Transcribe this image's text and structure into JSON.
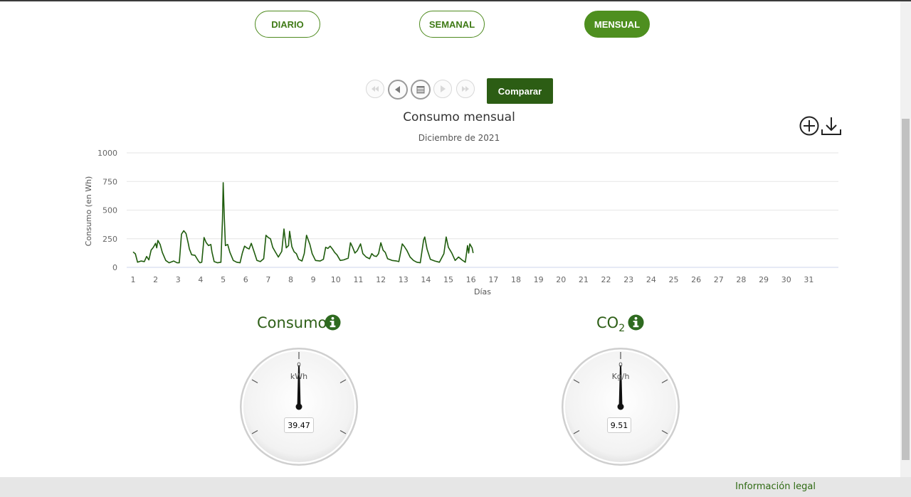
{
  "tabs": [
    {
      "label": "DIARIO",
      "active": false
    },
    {
      "label": "SEMANAL",
      "active": false
    },
    {
      "label": "MENSUAL",
      "active": true
    }
  ],
  "nav": {
    "compare_label": "Comparar",
    "buttons": [
      "first-icon",
      "prev-icon",
      "calendar-icon",
      "next-icon",
      "last-icon"
    ]
  },
  "tools": [
    "zoom-in-icon",
    "download-icon"
  ],
  "chart_data": {
    "type": "line",
    "title": "Consumo mensual",
    "subtitle": "Diciembre de 2021",
    "xlabel": "Días",
    "ylabel": "Consumo (en Wh)",
    "ylim": [
      0,
      1000
    ],
    "yticks": [
      "0",
      "250",
      "500",
      "750",
      "1000"
    ],
    "xlim": [
      1,
      32
    ],
    "xticks": [
      "1",
      "2",
      "3",
      "4",
      "5",
      "6",
      "7",
      "8",
      "9",
      "10",
      "11",
      "12",
      "13",
      "14",
      "15",
      "16",
      "17",
      "18",
      "19",
      "20",
      "21",
      "22",
      "23",
      "24",
      "25",
      "26",
      "27",
      "28",
      "29",
      "30",
      "31"
    ],
    "color": "#1f5c0d",
    "grid": true,
    "points": [
      [
        1.0,
        135
      ],
      [
        1.1,
        118
      ],
      [
        1.2,
        45
      ],
      [
        1.35,
        55
      ],
      [
        1.5,
        50
      ],
      [
        1.6,
        95
      ],
      [
        1.7,
        65
      ],
      [
        1.8,
        150
      ],
      [
        1.9,
        175
      ],
      [
        2.0,
        210
      ],
      [
        2.05,
        170
      ],
      [
        2.1,
        235
      ],
      [
        2.2,
        200
      ],
      [
        2.3,
        130
      ],
      [
        2.45,
        60
      ],
      [
        2.6,
        40
      ],
      [
        2.8,
        55
      ],
      [
        2.95,
        40
      ],
      [
        3.05,
        40
      ],
      [
        3.15,
        290
      ],
      [
        3.25,
        320
      ],
      [
        3.35,
        295
      ],
      [
        3.45,
        210
      ],
      [
        3.5,
        160
      ],
      [
        3.6,
        110
      ],
      [
        3.75,
        105
      ],
      [
        3.9,
        55
      ],
      [
        3.97,
        40
      ],
      [
        4.05,
        45
      ],
      [
        4.15,
        260
      ],
      [
        4.25,
        215
      ],
      [
        4.35,
        190
      ],
      [
        4.45,
        200
      ],
      [
        4.5,
        135
      ],
      [
        4.6,
        50
      ],
      [
        4.75,
        40
      ],
      [
        4.9,
        45
      ],
      [
        4.97,
        420
      ],
      [
        5.0,
        740
      ],
      [
        5.05,
        430
      ],
      [
        5.1,
        190
      ],
      [
        5.2,
        200
      ],
      [
        5.3,
        130
      ],
      [
        5.45,
        60
      ],
      [
        5.6,
        45
      ],
      [
        5.75,
        40
      ],
      [
        5.85,
        125
      ],
      [
        5.95,
        185
      ],
      [
        6.05,
        170
      ],
      [
        6.15,
        160
      ],
      [
        6.25,
        210
      ],
      [
        6.35,
        150
      ],
      [
        6.5,
        60
      ],
      [
        6.65,
        50
      ],
      [
        6.8,
        75
      ],
      [
        6.9,
        280
      ],
      [
        7.0,
        260
      ],
      [
        7.1,
        250
      ],
      [
        7.2,
        175
      ],
      [
        7.3,
        140
      ],
      [
        7.45,
        90
      ],
      [
        7.6,
        140
      ],
      [
        7.7,
        335
      ],
      [
        7.8,
        170
      ],
      [
        7.9,
        190
      ],
      [
        7.95,
        315
      ],
      [
        8.05,
        180
      ],
      [
        8.15,
        135
      ],
      [
        8.25,
        120
      ],
      [
        8.35,
        70
      ],
      [
        8.5,
        55
      ],
      [
        8.6,
        120
      ],
      [
        8.7,
        280
      ],
      [
        8.85,
        200
      ],
      [
        8.95,
        120
      ],
      [
        9.1,
        60
      ],
      [
        9.3,
        55
      ],
      [
        9.45,
        70
      ],
      [
        9.55,
        175
      ],
      [
        9.65,
        165
      ],
      [
        9.75,
        185
      ],
      [
        9.85,
        160
      ],
      [
        9.95,
        130
      ],
      [
        10.05,
        110
      ],
      [
        10.2,
        60
      ],
      [
        10.35,
        65
      ],
      [
        10.55,
        80
      ],
      [
        10.65,
        215
      ],
      [
        10.75,
        175
      ],
      [
        10.85,
        125
      ],
      [
        10.95,
        145
      ],
      [
        11.1,
        205
      ],
      [
        11.2,
        120
      ],
      [
        11.35,
        90
      ],
      [
        11.5,
        75
      ],
      [
        11.6,
        120
      ],
      [
        11.7,
        100
      ],
      [
        11.8,
        95
      ],
      [
        11.9,
        120
      ],
      [
        12.0,
        215
      ],
      [
        12.1,
        150
      ],
      [
        12.2,
        130
      ],
      [
        12.3,
        75
      ],
      [
        12.5,
        60
      ],
      [
        12.7,
        55
      ],
      [
        12.8,
        50
      ],
      [
        12.95,
        205
      ],
      [
        13.05,
        180
      ],
      [
        13.15,
        150
      ],
      [
        13.3,
        90
      ],
      [
        13.45,
        60
      ],
      [
        13.6,
        45
      ],
      [
        13.75,
        40
      ],
      [
        13.9,
        240
      ],
      [
        13.95,
        265
      ],
      [
        14.05,
        160
      ],
      [
        14.2,
        70
      ],
      [
        14.4,
        55
      ],
      [
        14.6,
        45
      ],
      [
        14.8,
        120
      ],
      [
        14.9,
        265
      ],
      [
        15.0,
        175
      ],
      [
        15.15,
        125
      ],
      [
        15.3,
        60
      ],
      [
        15.45,
        90
      ],
      [
        15.6,
        65
      ],
      [
        15.75,
        45
      ],
      [
        15.85,
        190
      ],
      [
        15.9,
        125
      ],
      [
        15.95,
        205
      ],
      [
        16.05,
        170
      ],
      [
        16.1,
        125
      ]
    ]
  },
  "gauges": [
    {
      "title": "Consumo",
      "unit": "kWh",
      "value": "39.47",
      "zero": "0"
    },
    {
      "title": "CO",
      "sub": "2",
      "unit": "Kg/h",
      "value": "9.51",
      "zero": "0"
    }
  ],
  "footer": {
    "legal": "Información legal"
  }
}
